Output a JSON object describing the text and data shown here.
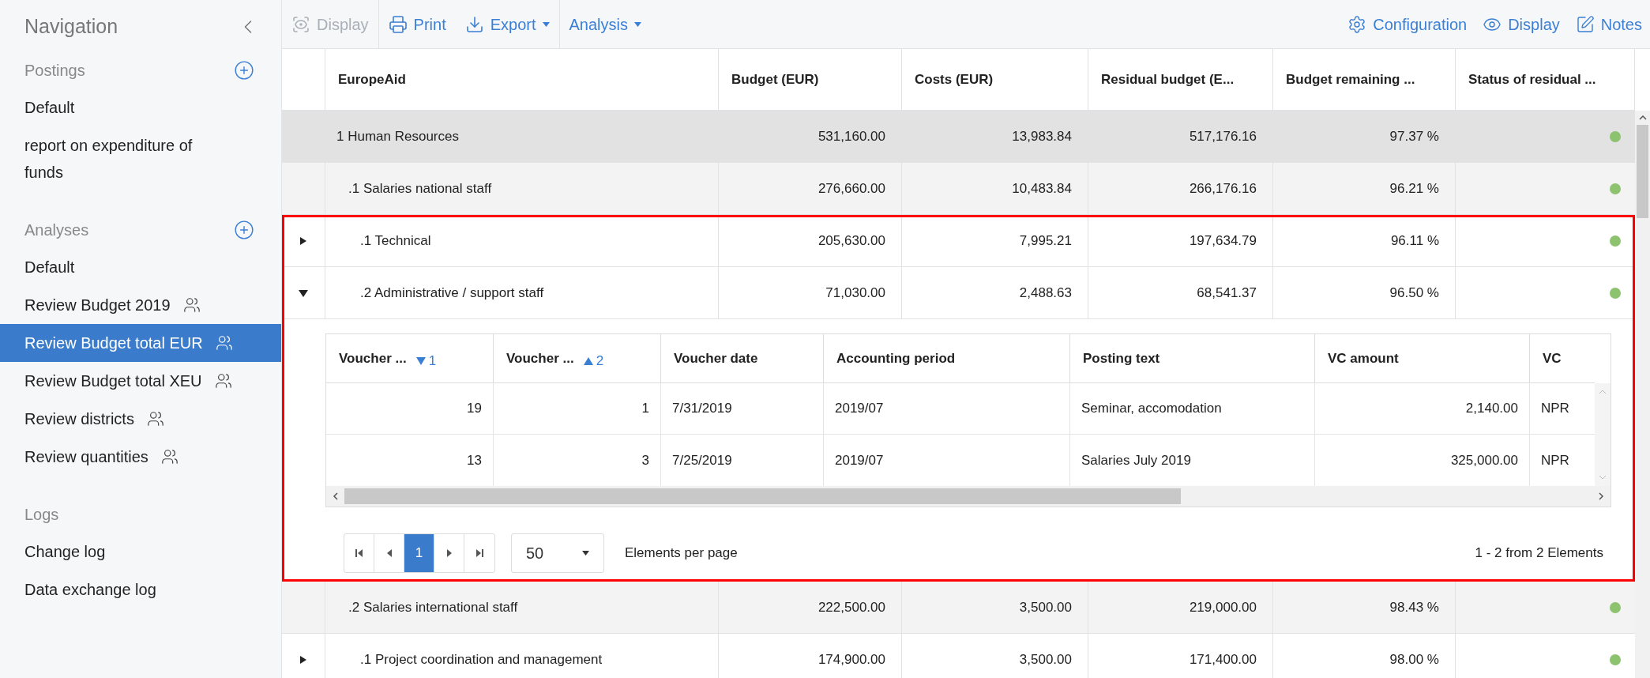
{
  "sidebar": {
    "title": "Navigation",
    "sections": [
      {
        "title": "Postings",
        "addable": true,
        "items": [
          {
            "label": "Default",
            "shared": false,
            "selected": false
          },
          {
            "label": "report on expenditure of funds",
            "shared": false,
            "selected": false
          }
        ]
      },
      {
        "title": "Analyses",
        "addable": true,
        "items": [
          {
            "label": "Default",
            "shared": false,
            "selected": false
          },
          {
            "label": "Review Budget 2019",
            "shared": true,
            "selected": false
          },
          {
            "label": "Review Budget total EUR",
            "shared": true,
            "selected": true
          },
          {
            "label": "Review Budget total XEU",
            "shared": true,
            "selected": false
          },
          {
            "label": "Review districts",
            "shared": true,
            "selected": false
          },
          {
            "label": "Review quantities",
            "shared": true,
            "selected": false
          }
        ]
      },
      {
        "title": "Logs",
        "addable": false,
        "items": [
          {
            "label": "Change log",
            "shared": false,
            "selected": false
          },
          {
            "label": "Data exchange log",
            "shared": false,
            "selected": false
          }
        ]
      }
    ]
  },
  "toolbar": {
    "left": [
      {
        "kind": "display",
        "label": "Display",
        "disabled": true,
        "dropdown": false
      },
      {
        "kind": "print",
        "label": "Print",
        "disabled": false,
        "dropdown": false
      },
      {
        "kind": "export",
        "label": "Export",
        "disabled": false,
        "dropdown": true
      },
      {
        "kind": "plain",
        "label": "Analysis",
        "disabled": false,
        "dropdown": true
      }
    ],
    "right": [
      {
        "kind": "configuration",
        "label": "Configuration"
      },
      {
        "kind": "display",
        "label": "Display"
      },
      {
        "kind": "notes",
        "label": "Notes"
      }
    ]
  },
  "table": {
    "columns": [
      "EuropeAid",
      "Budget (EUR)",
      "Costs (EUR)",
      "Residual budget (E...",
      "Budget remaining ...",
      "Status of residual ..."
    ],
    "rows": [
      {
        "cells": [
          "1 Human Resources",
          "531,160.00",
          "13,983.84",
          "517,176.16",
          "97.37 %"
        ],
        "color": "#8dc26f",
        "children": [
          {
            "cells": [
              ".1 Salaries national staff",
              "276,660.00",
              "10,483.84",
              "266,176.16",
              "96.21 %"
            ],
            "color": "#8dc26f",
            "children": [
              {
                "cells": [
                  ".1 Technical",
                  "205,630.00",
                  "7,995.21",
                  "197,634.79",
                  "96.11 %"
                ],
                "color": "#8dc26f",
                "expanded": false,
                "highlighted": true
              },
              {
                "cells": [
                  ".2 Administrative / support staff",
                  "71,030.00",
                  "2,488.63",
                  "68,541.37",
                  "96.50 %"
                ],
                "color": "#8dc26f",
                "expanded": true,
                "highlighted": true,
                "detail": {
                  "columns": [
                    {
                      "label": "Voucher ...",
                      "descending": true,
                      "order": "1",
                      "numeric": true
                    },
                    {
                      "label": "Voucher ...",
                      "descending": false,
                      "order": "2",
                      "numeric": true
                    },
                    {
                      "label": "Voucher date",
                      "numeric": false
                    },
                    {
                      "label": "Accounting period",
                      "numeric": false
                    },
                    {
                      "label": "Posting text",
                      "numeric": false
                    },
                    {
                      "label": "VC amount",
                      "numeric": true
                    },
                    {
                      "label": "VC",
                      "numeric": false
                    }
                  ],
                  "rows": [
                    [
                      "19",
                      "1",
                      "7/31/2019",
                      "2019/07",
                      "Seminar, accomodation",
                      "2,140.00",
                      "NPR"
                    ],
                    [
                      "13",
                      "3",
                      "7/25/2019",
                      "2019/07",
                      "Salaries July 2019",
                      "325,000.00",
                      "NPR"
                    ]
                  ],
                  "pager": {
                    "pages": [
                      {
                        "label": "1",
                        "selected": true
                      }
                    ],
                    "page_size": "50",
                    "page_size_label": "Elements per page",
                    "summary": "1 - 2 from 2 Elements"
                  }
                }
              }
            ]
          },
          {
            "cells": [
              ".2 Salaries international staff",
              "222,500.00",
              "3,500.00",
              "219,000.00",
              "98.43 %"
            ],
            "color": "#8dc26f",
            "children": [
              {
                "cells": [
                  ".1 Project coordination and management",
                  "174,900.00",
                  "3,500.00",
                  "171,400.00",
                  "98.00 %"
                ],
                "color": "#8dc26f",
                "expanded": false,
                "highlighted": false
              }
            ]
          }
        ]
      }
    ]
  }
}
